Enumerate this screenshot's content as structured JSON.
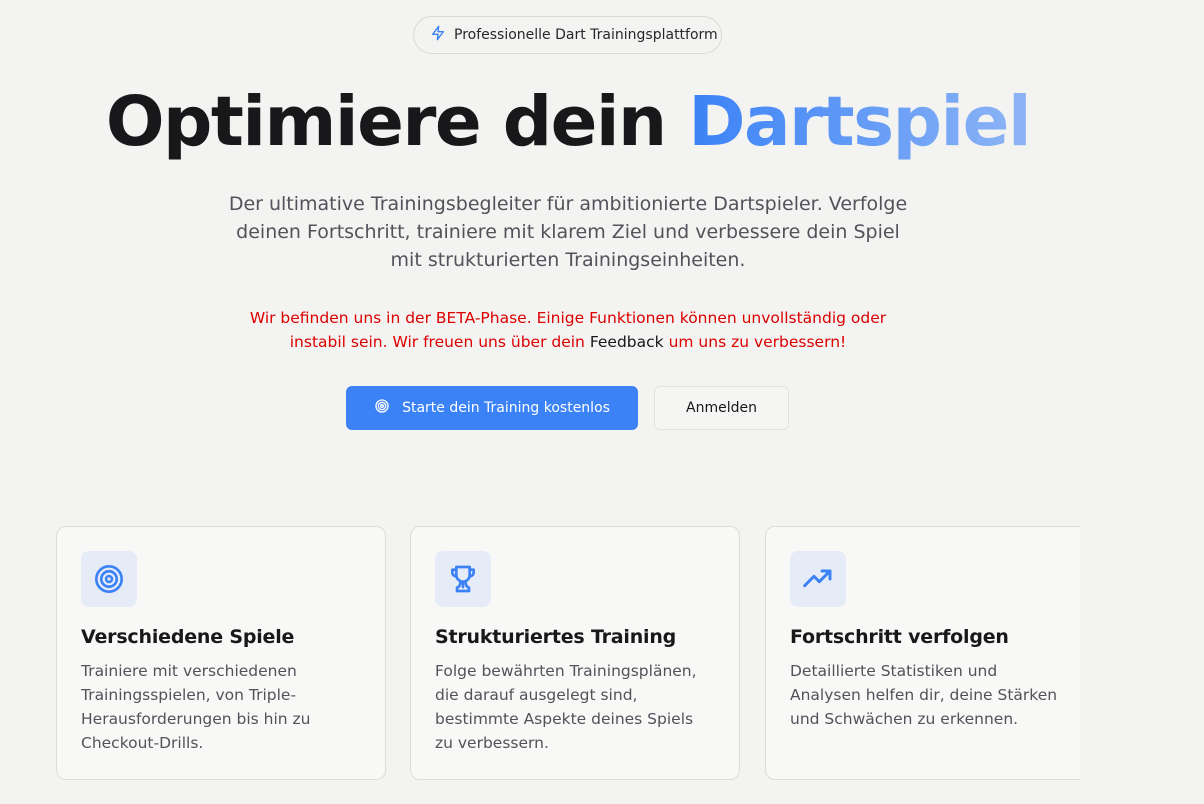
{
  "badge": {
    "label": "Professionelle Dart Trainingsplattform",
    "icon": "lightning-icon"
  },
  "hero": {
    "title_plain": "Optimiere dein ",
    "title_accent": "Dartspiel",
    "subtitle": "Der ultimative Trainingsbegleiter für ambitionierte Dartspieler. Verfolge deinen Fortschritt, trainiere mit klarem Ziel und verbessere dein Spiel mit strukturierten Trainingseinheiten."
  },
  "beta_notice": {
    "text_before": "Wir befinden uns in der BETA-Phase. Einige Funktionen können unvollständig oder instabil sein. Wir freuen uns über dein ",
    "link": "Feedback",
    "text_after": " um uns zu verbessern!"
  },
  "actions": {
    "primary_label": "Starte dein Training kostenlos",
    "secondary_label": "Anmelden"
  },
  "features": [
    {
      "icon": "target-icon",
      "title": "Verschiedene Spiele",
      "text": "Trainiere mit verschiedenen Trainingsspielen, von Triple-Herausforderungen bis hin zu Checkout-Drills."
    },
    {
      "icon": "trophy-icon",
      "title": "Strukturiertes Training",
      "text": "Folge bewährten Trainingsplänen, die darauf ausgelegt sind, bestimmte Aspekte deines Spiels zu verbessern."
    },
    {
      "icon": "trending-up-icon",
      "title": "Fortschritt verfolgen",
      "text": "Detaillierte Statistiken und Analysen helfen dir, deine Stärken und Schwächen zu erkennen."
    }
  ],
  "colors": {
    "accent": "#3b82f6",
    "warning": "#dc0000",
    "icon_bg": "#e5ecf8"
  }
}
